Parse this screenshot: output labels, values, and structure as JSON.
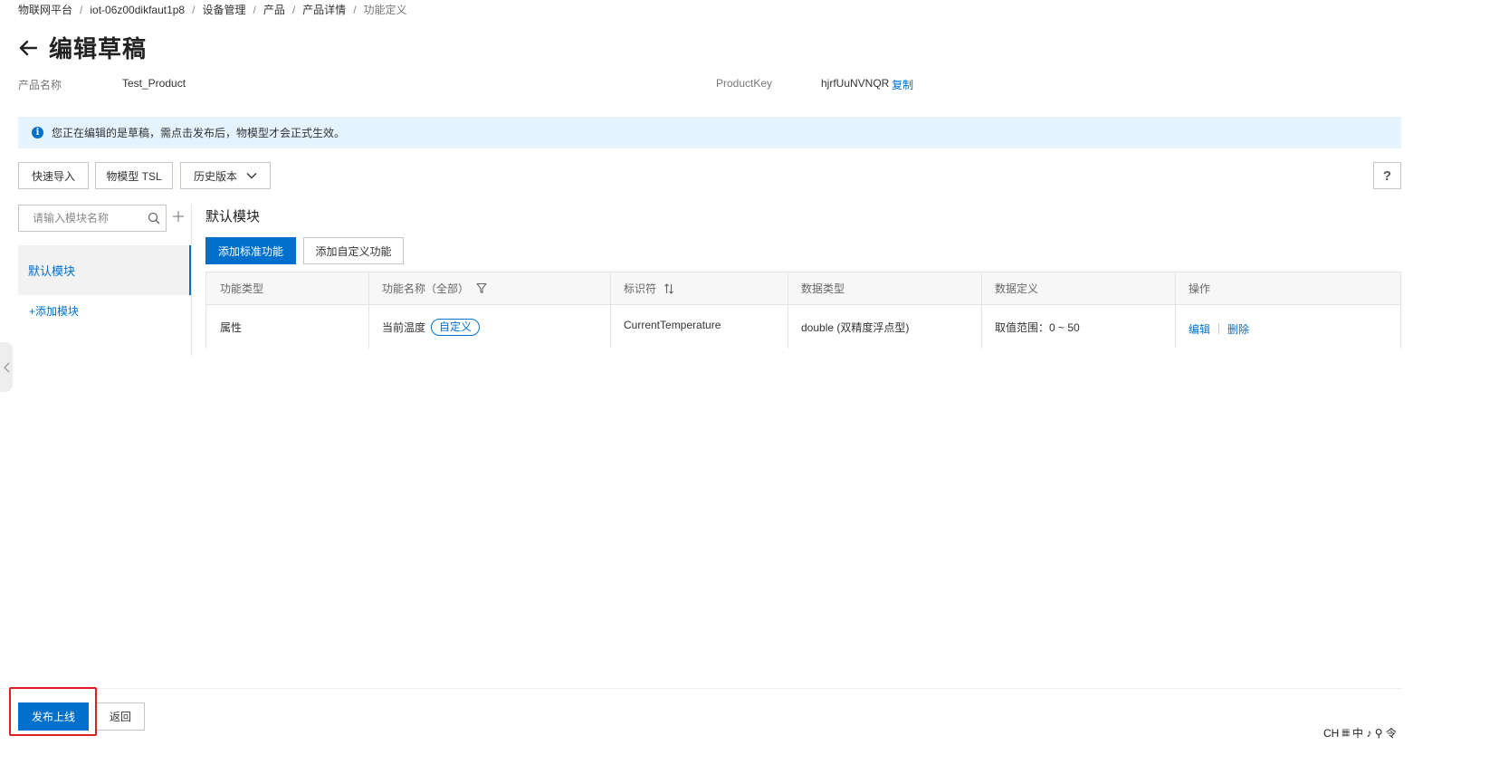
{
  "breadcrumb": {
    "items": [
      "物联网平台",
      "iot-06z00dikfaut1p8",
      "设备管理",
      "产品",
      "产品详情"
    ],
    "current": "功能定义",
    "separator": "/"
  },
  "header": {
    "title": "编辑草稿"
  },
  "product_info": {
    "name_label": "产品名称",
    "name_value": "Test_Product",
    "key_label": "ProductKey",
    "key_value": "hjrfUuNVNQR",
    "copy_label": "复制"
  },
  "notice": {
    "icon": "info-icon",
    "text": "您正在编辑的是草稿，需点击发布后，物模型才会正式生效。"
  },
  "toolbar": {
    "quick_import": "快速导入",
    "tsl": "物模型 TSL",
    "history": "历史版本",
    "help": "?"
  },
  "sidebar": {
    "search_placeholder": "请输入模块名称",
    "active_module": "默认模块",
    "add_module": "+添加模块"
  },
  "main": {
    "section_title": "默认模块",
    "add_standard": "添加标准功能",
    "add_custom": "添加自定义功能",
    "table": {
      "headers": [
        "功能类型",
        "功能名称（全部）",
        "标识符",
        "数据类型",
        "数据定义",
        "操作"
      ],
      "rows": [
        {
          "type": "属性",
          "name": "当前温度",
          "tag": "自定义",
          "identifier": "CurrentTemperature",
          "data_type": "double (双精度浮点型)",
          "definition": "取值范围：0 ~ 50",
          "edit": "编辑",
          "delete": "删除"
        }
      ]
    }
  },
  "footer": {
    "publish": "发布上线",
    "back": "返回"
  },
  "tray": {
    "text": "CH 𝄜 中 ♪ ⚲ 令"
  },
  "colors": {
    "primary": "#0070cc",
    "notice_bg": "#e5f3fe",
    "highlight": "#e02020"
  }
}
